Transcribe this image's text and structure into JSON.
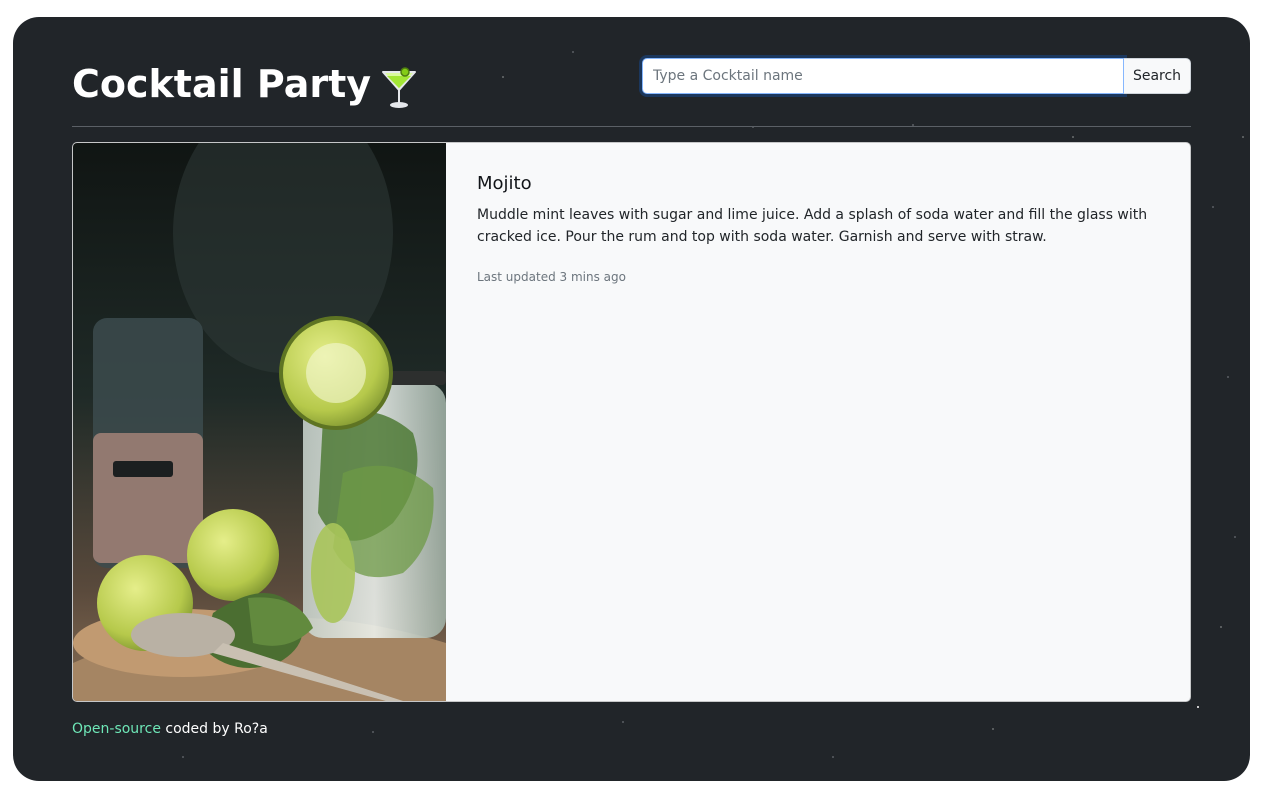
{
  "header": {
    "title": "Cocktail Party",
    "title_icon": "cocktail-glass-icon"
  },
  "search": {
    "placeholder": "Type a Cocktail name",
    "value": "",
    "button_label": "Search"
  },
  "card": {
    "image_icon": "mojito-photo",
    "drink_name": "Mojito",
    "instructions": "Muddle mint leaves with sugar and lime juice. Add a splash of soda water and fill the glass with cracked ice. Pour the rum and top with soda water. Garnish and serve with straw.",
    "updated": "Last updated 3 mins ago"
  },
  "footer": {
    "link_label": "Open-source",
    "text": " coded by Ro?a"
  },
  "colors": {
    "background": "#212529",
    "card": "#f8f9fa",
    "link": "#6ee7b7",
    "focus": "#86b7fe"
  }
}
